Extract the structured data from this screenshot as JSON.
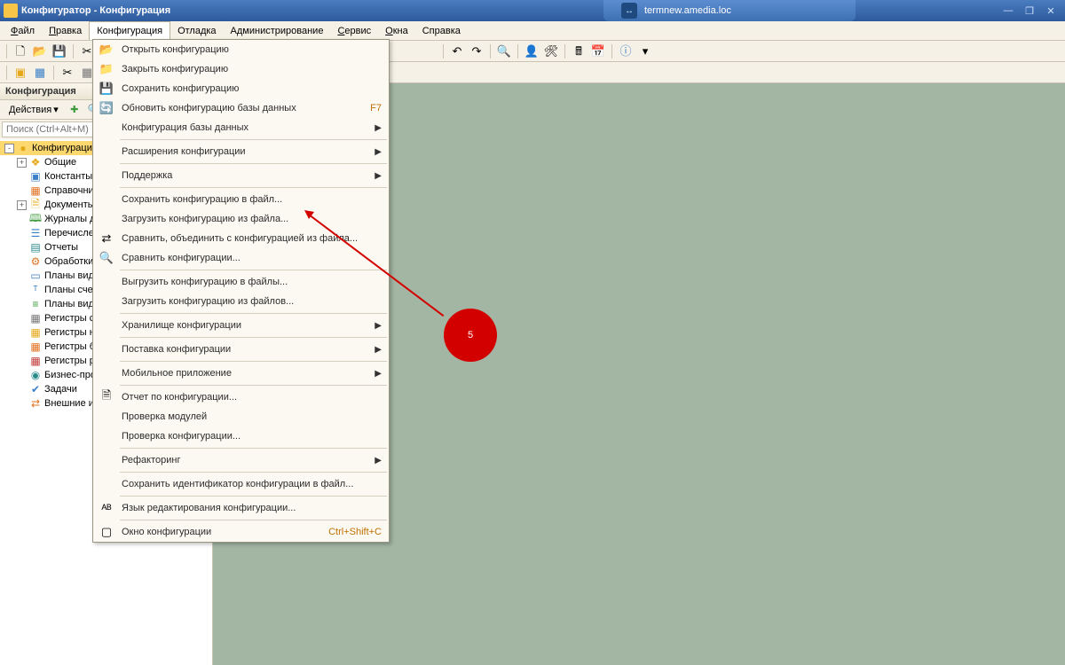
{
  "titlebar": {
    "text": "Конфигуратор - Конфигурация",
    "tab_label": "termnew.amedia.loc"
  },
  "menubar": {
    "items": [
      {
        "label": "Файл",
        "underline": 0
      },
      {
        "label": "Правка",
        "underline": 0
      },
      {
        "label": "Конфигурация",
        "underline": -1,
        "active": true
      },
      {
        "label": "Отладка",
        "underline": -1
      },
      {
        "label": "Администрирование",
        "underline": -1
      },
      {
        "label": "Сервис",
        "underline": 0
      },
      {
        "label": "Окна",
        "underline": 0
      },
      {
        "label": "Справка",
        "underline": -1
      }
    ]
  },
  "sidebar": {
    "panel_title": "Конфигурация",
    "actions_label": "Действия",
    "search_placeholder": "Поиск (Ctrl+Alt+M)"
  },
  "tree": {
    "items": [
      {
        "label": "Конфигурация",
        "level": 0,
        "selected": true,
        "expander": "-",
        "icon": "●",
        "iconClass": "ic-yellow"
      },
      {
        "label": "Общие",
        "level": 1,
        "expander": "+",
        "icon": "❖",
        "iconClass": "ic-yellow"
      },
      {
        "label": "Константы",
        "level": 1,
        "expander": "",
        "icon": "▣",
        "iconClass": "ic-blue"
      },
      {
        "label": "Справочники",
        "level": 1,
        "expander": "",
        "icon": "▦",
        "iconClass": "ic-orange"
      },
      {
        "label": "Документы",
        "level": 1,
        "expander": "+",
        "icon": "🗎",
        "iconClass": "ic-yellow"
      },
      {
        "label": "Журналы документов",
        "level": 1,
        "expander": "",
        "icon": "🕮",
        "iconClass": "ic-green"
      },
      {
        "label": "Перечисления",
        "level": 1,
        "expander": "",
        "icon": "☰",
        "iconClass": "ic-blue"
      },
      {
        "label": "Отчеты",
        "level": 1,
        "expander": "",
        "icon": "▤",
        "iconClass": "ic-teal"
      },
      {
        "label": "Обработки",
        "level": 1,
        "expander": "",
        "icon": "⚙",
        "iconClass": "ic-orange"
      },
      {
        "label": "Планы видов характеристик",
        "level": 1,
        "expander": "",
        "icon": "▭",
        "iconClass": "ic-blue"
      },
      {
        "label": "Планы счетов",
        "level": 1,
        "expander": "",
        "icon": "ᵀ",
        "iconClass": "ic-blue"
      },
      {
        "label": "Планы видов расчета",
        "level": 1,
        "expander": "",
        "icon": "≡",
        "iconClass": "ic-green"
      },
      {
        "label": "Регистры сведений",
        "level": 1,
        "expander": "",
        "icon": "▦",
        "iconClass": "ic-gray"
      },
      {
        "label": "Регистры накопления",
        "level": 1,
        "expander": "",
        "icon": "▦",
        "iconClass": "ic-yellow"
      },
      {
        "label": "Регистры бухгалтерии",
        "level": 1,
        "expander": "",
        "icon": "▦",
        "iconClass": "ic-orange"
      },
      {
        "label": "Регистры расчета",
        "level": 1,
        "expander": "",
        "icon": "▦",
        "iconClass": "ic-red"
      },
      {
        "label": "Бизнес-процессы",
        "level": 1,
        "expander": "",
        "icon": "◉",
        "iconClass": "ic-teal"
      },
      {
        "label": "Задачи",
        "level": 1,
        "expander": "",
        "icon": "✔",
        "iconClass": "ic-blue"
      },
      {
        "label": "Внешние источники данных",
        "level": 1,
        "expander": "",
        "icon": "⇄",
        "iconClass": "ic-orange"
      }
    ]
  },
  "dropdown": {
    "items": [
      {
        "type": "item",
        "label": "Открыть конфигурацию",
        "icon": "📂"
      },
      {
        "type": "item",
        "label": "Закрыть конфигурацию",
        "icon": "📁"
      },
      {
        "type": "item",
        "label": "Сохранить конфигурацию",
        "icon": "💾"
      },
      {
        "type": "item",
        "label": "Обновить конфигурацию базы данных",
        "icon": "🔄",
        "shortcut": "F7"
      },
      {
        "type": "submenu",
        "label": "Конфигурация базы данных"
      },
      {
        "type": "sep"
      },
      {
        "type": "submenu",
        "label": "Расширения конфигурации"
      },
      {
        "type": "sep"
      },
      {
        "type": "submenu",
        "label": "Поддержка"
      },
      {
        "type": "sep"
      },
      {
        "type": "item",
        "label": "Сохранить конфигурацию в файл..."
      },
      {
        "type": "item",
        "label": "Загрузить конфигурацию из файла..."
      },
      {
        "type": "item",
        "label": "Сравнить, объединить с конфигурацией из файла...",
        "icon": "⇄"
      },
      {
        "type": "item",
        "label": "Сравнить конфигурации...",
        "icon": "🔍"
      },
      {
        "type": "sep"
      },
      {
        "type": "item",
        "label": "Выгрузить конфигурацию в файлы..."
      },
      {
        "type": "item",
        "label": "Загрузить конфигурацию из файлов..."
      },
      {
        "type": "sep"
      },
      {
        "type": "submenu",
        "label": "Хранилище конфигурации"
      },
      {
        "type": "sep"
      },
      {
        "type": "submenu",
        "label": "Поставка конфигурации"
      },
      {
        "type": "sep"
      },
      {
        "type": "submenu",
        "label": "Мобильное приложение"
      },
      {
        "type": "sep"
      },
      {
        "type": "item",
        "label": "Отчет по конфигурации...",
        "icon": "🗎"
      },
      {
        "type": "item",
        "label": "Проверка модулей"
      },
      {
        "type": "item",
        "label": "Проверка конфигурации..."
      },
      {
        "type": "sep"
      },
      {
        "type": "submenu",
        "label": "Рефакторинг"
      },
      {
        "type": "sep"
      },
      {
        "type": "item",
        "label": "Сохранить идентификатор конфигурации в файл..."
      },
      {
        "type": "sep"
      },
      {
        "type": "item",
        "label": "Язык редактирования конфигурации...",
        "icon": "ᴬᴮ"
      },
      {
        "type": "sep"
      },
      {
        "type": "item",
        "label": "Окно конфигурации",
        "icon": "▢",
        "shortcut": "Ctrl+Shift+C"
      }
    ]
  },
  "annotation": {
    "number": "5"
  }
}
